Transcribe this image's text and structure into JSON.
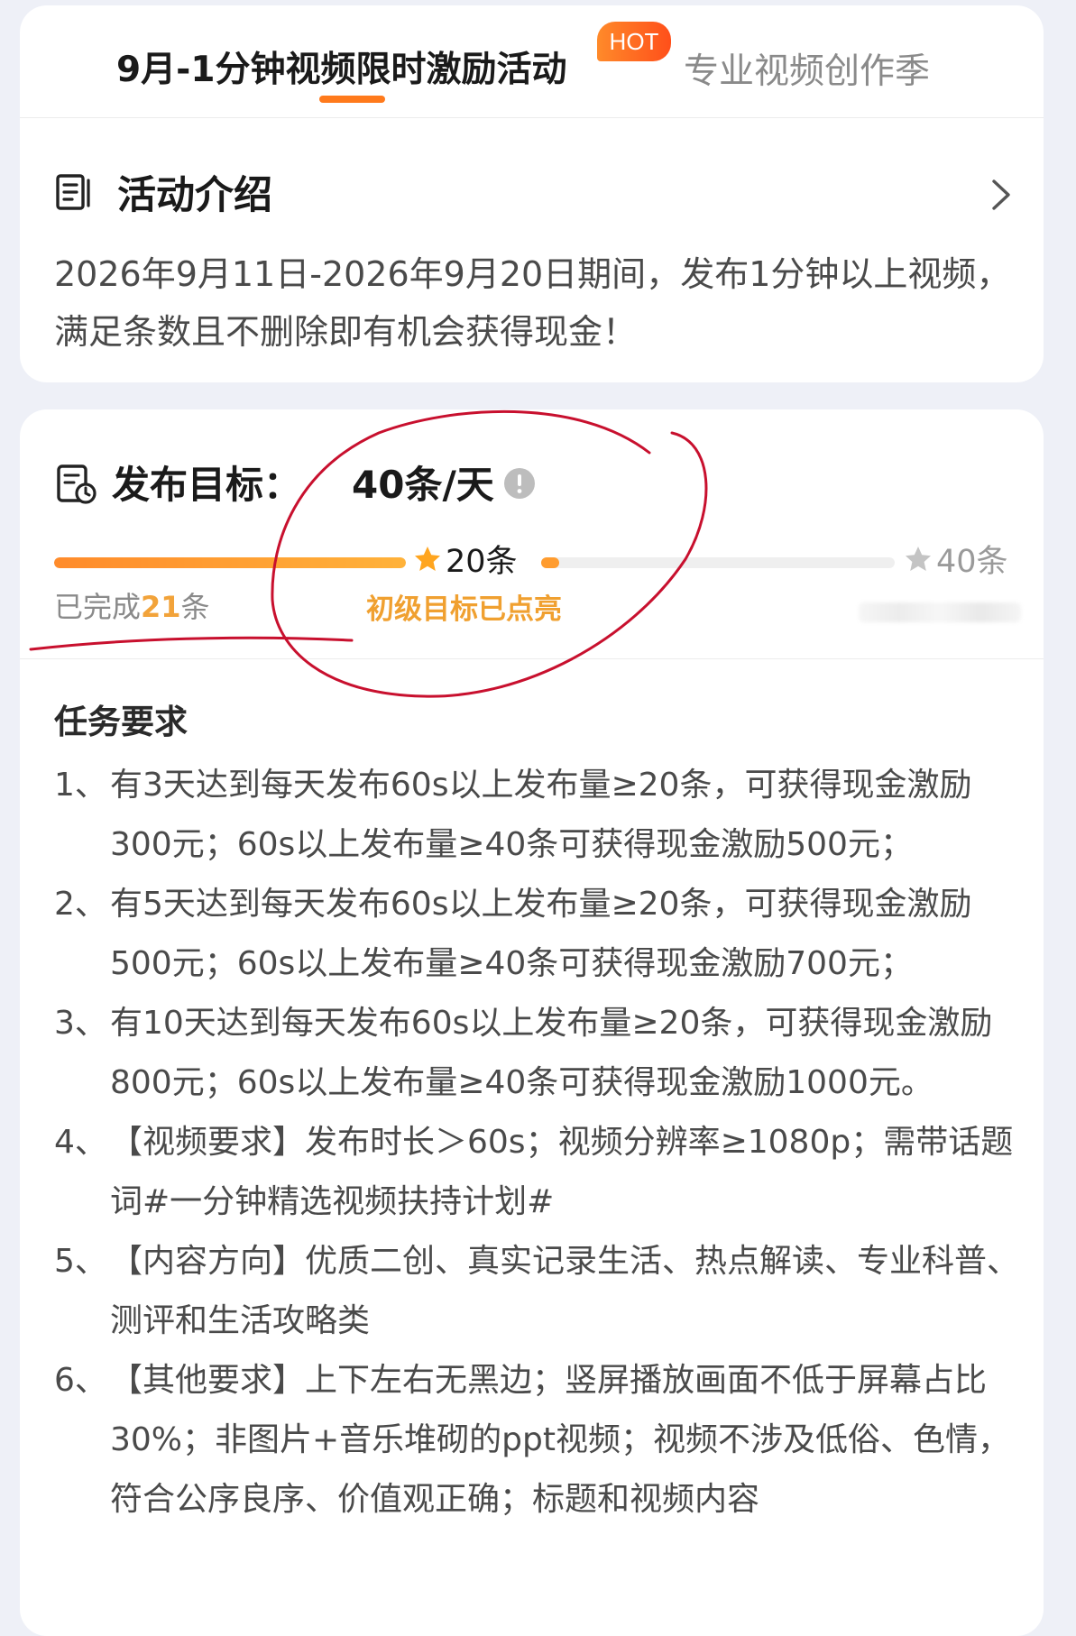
{
  "tabs": {
    "active": "9月-1分钟视频限时激励活动",
    "hot_badge": "HOT",
    "inactive": "专业视频创作季"
  },
  "intro": {
    "title": "活动介绍",
    "text": "2026年9月11日-2026年9月20日期间，发布1分钟以上视频，满足条数且不删除即有机会获得现金！"
  },
  "goal": {
    "label": "发布目标：",
    "value": "40条/天",
    "milestone_1": "20条",
    "milestone_2": "40条",
    "done_prefix": "已完成",
    "done_count": "21",
    "done_suffix": "条",
    "lit_text": "初级目标已点亮",
    "progress_segment_1": 1.0,
    "progress_segment_2": 0.05
  },
  "tasks": {
    "title": "任务要求",
    "items": [
      {
        "num": "1、",
        "text": "有3天达到每天发布60s以上发布量≥20条，可获得现金激励300元；60s以上发布量≥40条可获得现金激励500元；"
      },
      {
        "num": "2、",
        "text": "有5天达到每天发布60s以上发布量≥20条，可获得现金激励500元；60s以上发布量≥40条可获得现金激励700元；"
      },
      {
        "num": "3、",
        "text": "有10天达到每天发布60s以上发布量≥20条，可获得现金激励800元；60s以上发布量≥40条可获得现金激励1000元。"
      },
      {
        "num": "4、",
        "text": "【视频要求】发布时长＞60s；视频分辨率≥1080p；需带话题词#一分钟精选视频扶持计划#"
      },
      {
        "num": "5、",
        "text": "【内容方向】优质二创、真实记录生活、热点解读、专业科普、测评和生活攻略类"
      },
      {
        "num": "6、",
        "text": "【其他要求】上下左右无黑边；竖屏播放画面不低于屏幕占比30%；非图片+音乐堆砌的ppt视频；视频不涉及低俗、色情，符合公序良序、价值观正确；标题和视频内容"
      }
    ]
  },
  "colors": {
    "accent": "#ff7a1c",
    "progress": "#ffa032",
    "highlight_text": "#f0a030",
    "annotation_red": "#c8102e"
  },
  "icons": {
    "doc": "document-icon",
    "goal": "goal-clipboard-icon",
    "info": "info-icon",
    "star": "star-icon",
    "chevron": "chevron-right-icon"
  }
}
